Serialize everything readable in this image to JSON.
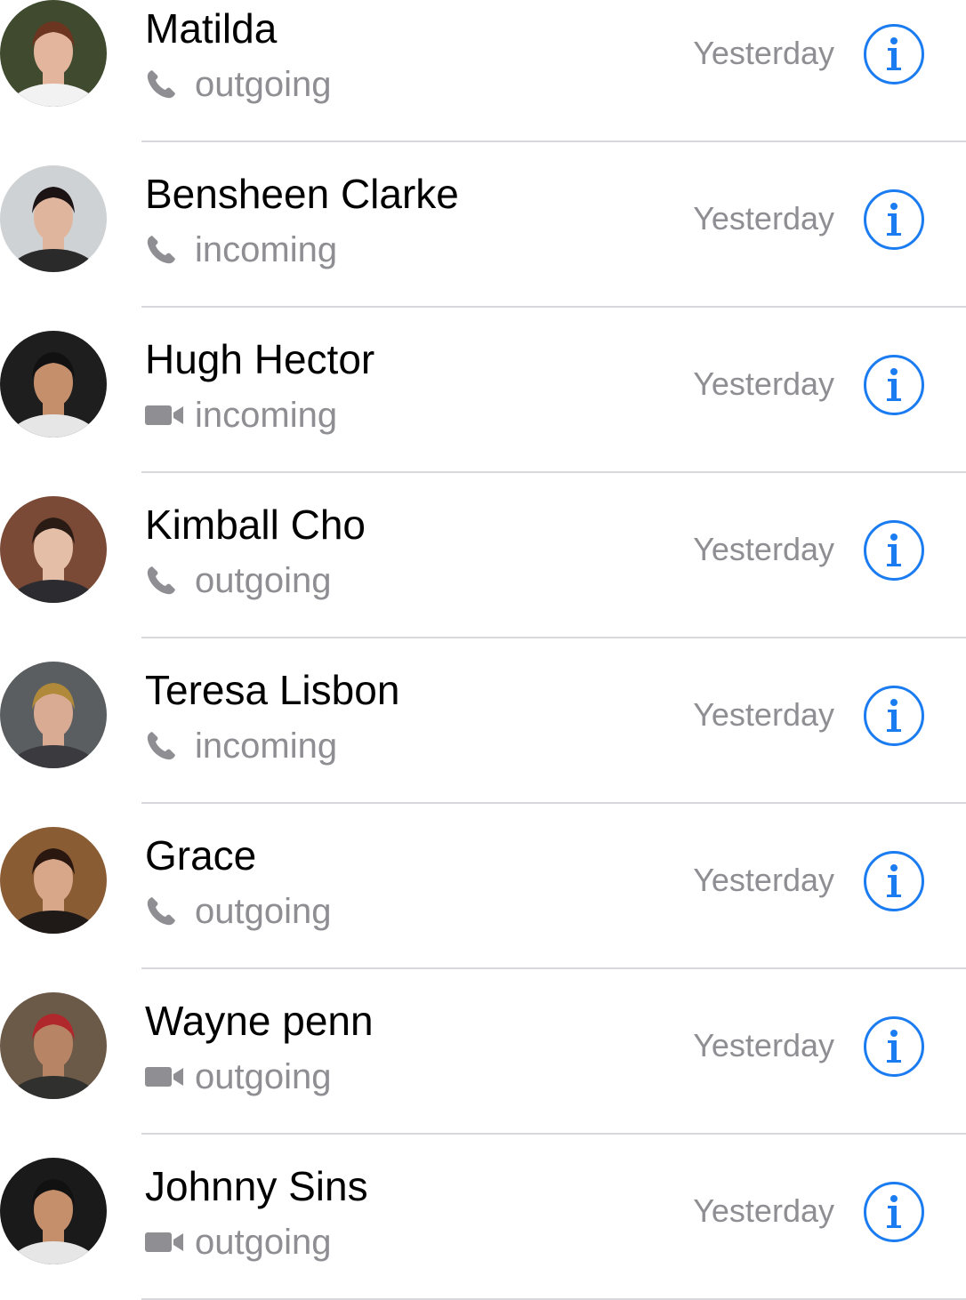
{
  "colors": {
    "accent": "#1a7cf0",
    "secondary_text": "#8e8e93",
    "separator": "#d8d8dc"
  },
  "calls": [
    {
      "name": "Matilda",
      "call_icon": "phone-icon",
      "direction": "outgoing",
      "time": "Yesterday"
    },
    {
      "name": "Bensheen Clarke",
      "call_icon": "phone-icon",
      "direction": "incoming",
      "time": "Yesterday"
    },
    {
      "name": "Hugh Hector",
      "call_icon": "video-camera-icon",
      "direction": "incoming",
      "time": "Yesterday"
    },
    {
      "name": "Kimball Cho",
      "call_icon": "phone-icon",
      "direction": "outgoing",
      "time": "Yesterday"
    },
    {
      "name": "Teresa Lisbon",
      "call_icon": "phone-icon",
      "direction": "incoming",
      "time": "Yesterday"
    },
    {
      "name": "Grace",
      "call_icon": "phone-icon",
      "direction": "outgoing",
      "time": "Yesterday"
    },
    {
      "name": "Wayne penn",
      "call_icon": "video-camera-icon",
      "direction": "outgoing",
      "time": "Yesterday"
    },
    {
      "name": "Johnny Sins",
      "call_icon": "video-camera-icon",
      "direction": "outgoing",
      "time": "Yesterday"
    }
  ]
}
